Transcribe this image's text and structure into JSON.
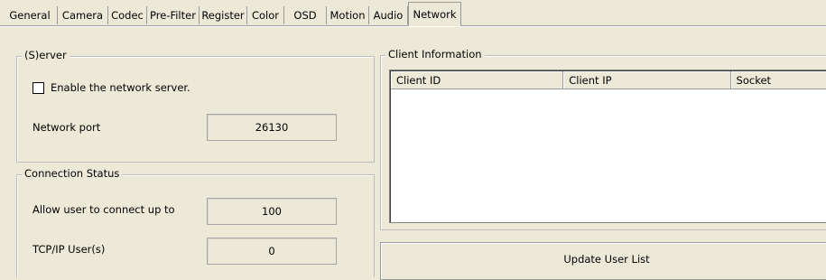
{
  "tabs": [
    {
      "label": "General"
    },
    {
      "label": "Camera"
    },
    {
      "label": "Codec"
    },
    {
      "label": "Pre-Filter"
    },
    {
      "label": "Register"
    },
    {
      "label": "Color"
    },
    {
      "label": "OSD"
    },
    {
      "label": "Motion"
    },
    {
      "label": "Audio"
    },
    {
      "label": "Network",
      "active": true
    }
  ],
  "server": {
    "legend": "(S)erver",
    "enable_label": "Enable the network server.",
    "enable_checked": false,
    "port_label": "Network port",
    "port_value": "26130"
  },
  "connection": {
    "legend": "Connection Status",
    "allow_label": "Allow user to connect up to",
    "allow_value": "100",
    "tcp_label": "TCP/IP User(s)",
    "tcp_value": "0"
  },
  "client": {
    "legend": "Client Information",
    "columns": [
      "Client ID",
      "Client IP",
      "Socket"
    ],
    "rows": [],
    "update_button": "Update User List"
  }
}
